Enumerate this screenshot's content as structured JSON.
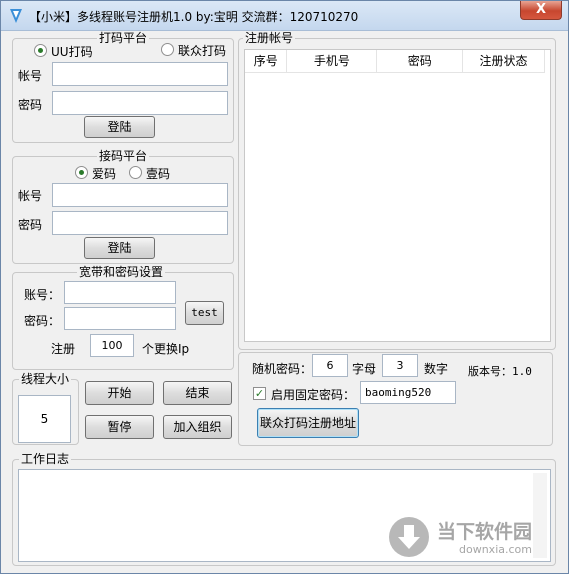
{
  "title": "【小米】多线程账号注册机1.0  by:宝明  交流群：120710270",
  "close_glyph": "X",
  "captcha_platform": {
    "legend": "打码平台",
    "opt1": "UU打码",
    "opt2": "联众打码",
    "account_label": "帐号",
    "password_label": "密码",
    "login": "登陆"
  },
  "sms_platform": {
    "legend": "接码平台",
    "opt1": "爱码",
    "opt2": "壹码",
    "account_label": "帐号",
    "password_label": "密码",
    "login": "登陆"
  },
  "broadband": {
    "legend": "宽带和密码设置",
    "account_label": "账号：",
    "password_label": "密码：",
    "test": "test",
    "register_label": "注册",
    "count": "100",
    "suffix": "个更换Ip"
  },
  "thread": {
    "legend": "线程大小",
    "value": "5"
  },
  "controls": {
    "start": "开始",
    "end": "结束",
    "pause": "暂停",
    "join": "加入组织"
  },
  "accounts": {
    "legend": "注册帐号",
    "columns": [
      "序号",
      "手机号",
      "密码",
      "注册状态"
    ]
  },
  "settings": {
    "random_label": "随机密码：",
    "letters_value": "6",
    "letters_label": "字母",
    "digits_value": "3",
    "digits_label": "数字",
    "version": "版本号：1.0",
    "fixed_label": "启用固定密码：",
    "fixed_value": "baoming520",
    "fixed_checked": true,
    "register_link": "联众打码注册地址"
  },
  "log": {
    "legend": "工作日志"
  },
  "watermark": {
    "text": "当下软件园",
    "url": "downxia.com"
  }
}
